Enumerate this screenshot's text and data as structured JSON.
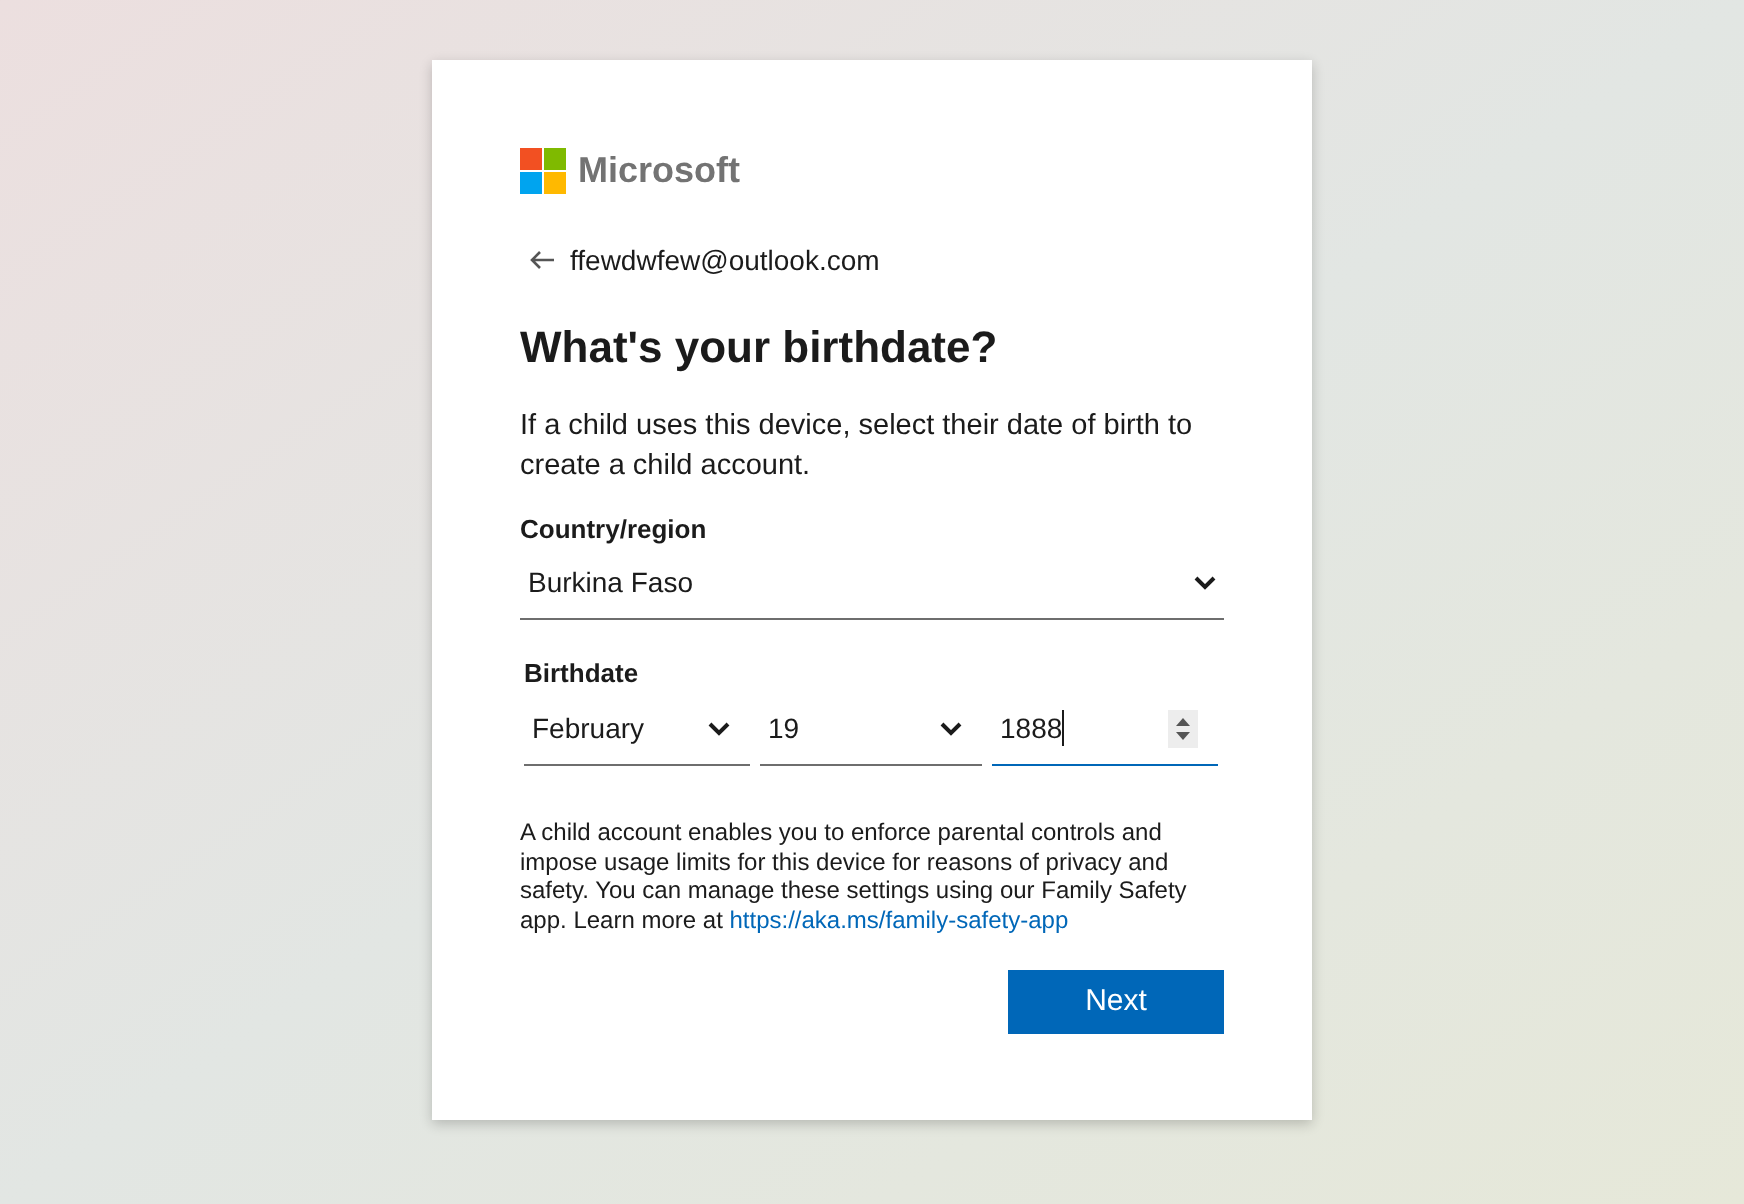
{
  "logo": {
    "wordmark": "Microsoft"
  },
  "account": {
    "email": "ffewdwfew@outlook.com"
  },
  "heading": "What's your birthdate?",
  "intro": "If a child uses this device, select their date of birth to create a child account.",
  "country": {
    "label": "Country/region",
    "value": "Burkina Faso"
  },
  "birthdate": {
    "label": "Birthdate",
    "fields": [
      {
        "kind": "select",
        "value": "February",
        "focused": false
      },
      {
        "kind": "select",
        "value": "19",
        "focused": false
      },
      {
        "kind": "number",
        "value": "1888",
        "focused": true
      }
    ]
  },
  "notice": {
    "text": "A child account enables you to enforce parental controls and impose usage limits for this device for reasons of privacy and safety. You can manage these settings using our Family Safety app. Learn more at ",
    "link": "https://aka.ms/family-safety-app"
  },
  "primary_button": {
    "label": "Next"
  }
}
